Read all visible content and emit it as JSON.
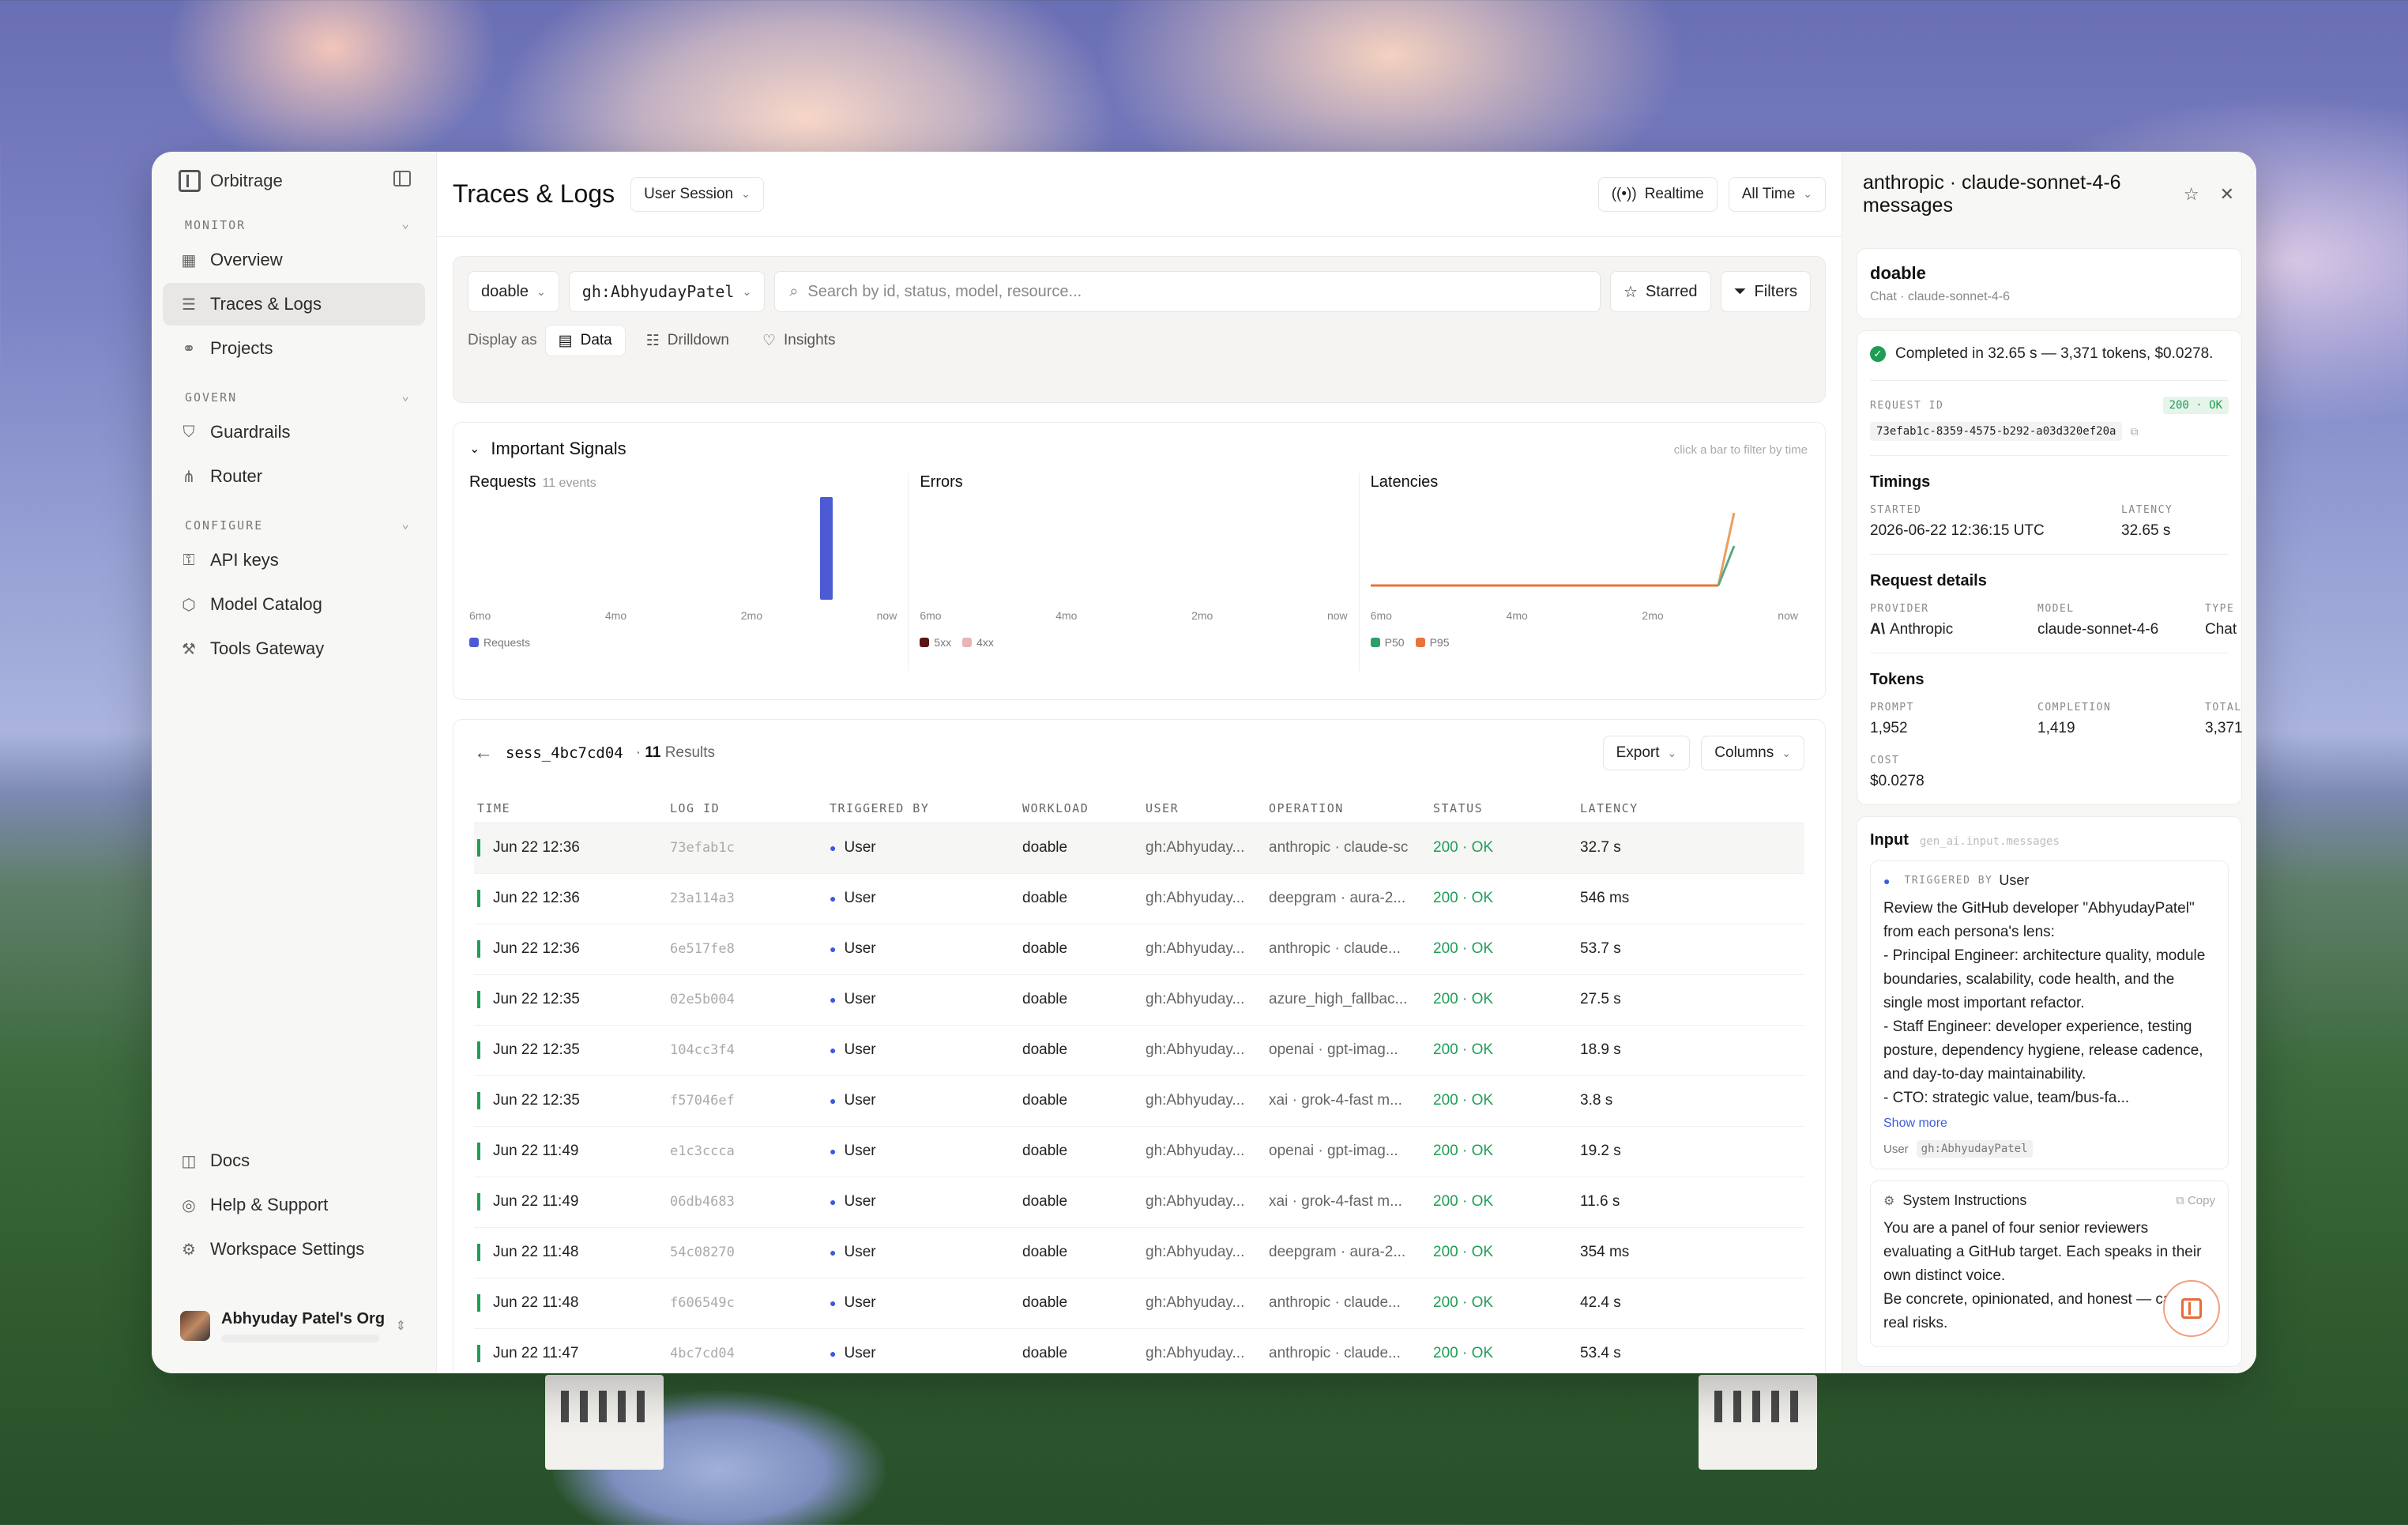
{
  "app": {
    "name": "Orbitrage"
  },
  "sidebar": {
    "sections": [
      {
        "label": "MONITOR",
        "items": [
          {
            "label": "Overview",
            "icon": "grid-icon"
          },
          {
            "label": "Traces & Logs",
            "icon": "list-search-icon",
            "active": true
          },
          {
            "label": "Projects",
            "icon": "share-nodes-icon"
          }
        ]
      },
      {
        "label": "GOVERN",
        "items": [
          {
            "label": "Guardrails",
            "icon": "shield-icon"
          },
          {
            "label": "Router",
            "icon": "router-icon"
          }
        ]
      },
      {
        "label": "CONFIGURE",
        "items": [
          {
            "label": "API keys",
            "icon": "key-icon"
          },
          {
            "label": "Model Catalog",
            "icon": "cube-icon"
          },
          {
            "label": "Tools Gateway",
            "icon": "wrench-icon"
          }
        ]
      }
    ],
    "bottom": [
      {
        "label": "Docs",
        "icon": "book-icon"
      },
      {
        "label": "Help & Support",
        "icon": "help-icon"
      },
      {
        "label": "Workspace Settings",
        "icon": "gear-icon"
      }
    ],
    "org_name": "Abhyuday Patel's Org"
  },
  "topbar": {
    "title": "Traces & Logs",
    "session_select": "User Session",
    "realtime": "Realtime",
    "time_range": "All Time"
  },
  "filters": {
    "project": "doable",
    "user": "gh:AbhyudayPatel",
    "search_placeholder": "Search by id, status, model, resource...",
    "starred": "Starred",
    "filters": "Filters",
    "display_as": "Display as",
    "tabs": [
      "Data",
      "Drilldown",
      "Insights"
    ]
  },
  "signals": {
    "title": "Important Signals",
    "hint": "click a bar to filter by time",
    "requests_title": "Requests",
    "requests_sub": "11 events",
    "errors_title": "Errors",
    "latencies_title": "Latencies",
    "ticks": [
      "6mo",
      "4mo",
      "2mo",
      "now"
    ],
    "legend_requests": "Requests",
    "legend_5xx": "5xx",
    "legend_4xx": "4xx",
    "legend_p50": "P50",
    "legend_p95": "P95"
  },
  "chart_data": [
    {
      "type": "bar",
      "title": "Requests",
      "categories": [
        "6mo",
        "4mo",
        "2mo",
        "now"
      ],
      "series": [
        {
          "name": "Requests",
          "values": [
            0,
            0,
            0,
            11
          ]
        }
      ],
      "color": "#4c5bd4"
    },
    {
      "type": "bar",
      "title": "Errors",
      "categories": [
        "6mo",
        "4mo",
        "2mo",
        "now"
      ],
      "series": [
        {
          "name": "5xx",
          "values": [
            0,
            0,
            0,
            0
          ]
        },
        {
          "name": "4xx",
          "values": [
            0,
            0,
            0,
            0
          ]
        }
      ]
    },
    {
      "type": "line",
      "title": "Latencies",
      "categories": [
        "6mo",
        "4mo",
        "2mo",
        "now"
      ],
      "series": [
        {
          "name": "P50",
          "color": "#2e9e6b"
        },
        {
          "name": "P95",
          "color": "#e8743b"
        }
      ]
    }
  ],
  "results": {
    "session": "sess_4bc7cd04",
    "count": "11",
    "count_label": "Results",
    "export": "Export",
    "columns_btn": "Columns",
    "headers": [
      "TIME",
      "LOG ID",
      "TRIGGERED BY",
      "WORKLOAD",
      "USER",
      "OPERATION",
      "STATUS",
      "LATENCY"
    ],
    "rows": [
      {
        "time": "Jun 22 12:36",
        "log_id": "73efab1c",
        "trigger": "User",
        "workload": "doable",
        "user": "gh:Abhyuday...",
        "operation": "anthropic · claude-sc",
        "status": "200 · OK",
        "latency": "32.7 s"
      },
      {
        "time": "Jun 22 12:36",
        "log_id": "23a114a3",
        "trigger": "User",
        "workload": "doable",
        "user": "gh:Abhyuday...",
        "operation": "deepgram · aura-2...",
        "status": "200 · OK",
        "latency": "546 ms"
      },
      {
        "time": "Jun 22 12:36",
        "log_id": "6e517fe8",
        "trigger": "User",
        "workload": "doable",
        "user": "gh:Abhyuday...",
        "operation": "anthropic · claude...",
        "status": "200 · OK",
        "latency": "53.7 s"
      },
      {
        "time": "Jun 22 12:35",
        "log_id": "02e5b004",
        "trigger": "User",
        "workload": "doable",
        "user": "gh:Abhyuday...",
        "operation": "azure_high_fallbac...",
        "status": "200 · OK",
        "latency": "27.5 s"
      },
      {
        "time": "Jun 22 12:35",
        "log_id": "104cc3f4",
        "trigger": "User",
        "workload": "doable",
        "user": "gh:Abhyuday...",
        "operation": "openai · gpt-imag...",
        "status": "200 · OK",
        "latency": "18.9 s"
      },
      {
        "time": "Jun 22 12:35",
        "log_id": "f57046ef",
        "trigger": "User",
        "workload": "doable",
        "user": "gh:Abhyuday...",
        "operation": "xai · grok-4-fast m...",
        "status": "200 · OK",
        "latency": "3.8 s"
      },
      {
        "time": "Jun 22 11:49",
        "log_id": "e1c3ccca",
        "trigger": "User",
        "workload": "doable",
        "user": "gh:Abhyuday...",
        "operation": "openai · gpt-imag...",
        "status": "200 · OK",
        "latency": "19.2 s"
      },
      {
        "time": "Jun 22 11:49",
        "log_id": "06db4683",
        "trigger": "User",
        "workload": "doable",
        "user": "gh:Abhyuday...",
        "operation": "xai · grok-4-fast m...",
        "status": "200 · OK",
        "latency": "11.6 s"
      },
      {
        "time": "Jun 22 11:48",
        "log_id": "54c08270",
        "trigger": "User",
        "workload": "doable",
        "user": "gh:Abhyuday...",
        "operation": "deepgram · aura-2...",
        "status": "200 · OK",
        "latency": "354 ms"
      },
      {
        "time": "Jun 22 11:48",
        "log_id": "f606549c",
        "trigger": "User",
        "workload": "doable",
        "user": "gh:Abhyuday...",
        "operation": "anthropic · claude...",
        "status": "200 · OK",
        "latency": "42.4 s"
      },
      {
        "time": "Jun 22 11:47",
        "log_id": "4bc7cd04",
        "trigger": "User",
        "workload": "doable",
        "user": "gh:Abhyuday...",
        "operation": "anthropic · claude...",
        "status": "200 · OK",
        "latency": "53.4 s"
      }
    ]
  },
  "detail": {
    "title": "anthropic · claude-sonnet-4-6 messages",
    "workload": "doable",
    "workload_sub": "Chat · claude-sonnet-4-6",
    "completed": "Completed in 32.65 s — 3,371 tokens, $0.0278.",
    "request_id_label": "REQUEST ID",
    "status_badge": "200 · OK",
    "request_id": "73efab1c-8359-4575-b292-a03d320ef20a",
    "timings_title": "Timings",
    "started_label": "STARTED",
    "started": "2026-06-22 12:36:15 UTC",
    "latency_label": "LATENCY",
    "latency": "32.65 s",
    "request_details_title": "Request details",
    "provider_label": "PROVIDER",
    "provider": "Anthropic",
    "model_label": "MODEL",
    "model": "claude-sonnet-4-6",
    "type_label": "TYPE",
    "type": "Chat",
    "tokens_title": "Tokens",
    "prompt_label": "PROMPT",
    "prompt": "1,952",
    "completion_label": "COMPLETION",
    "completion": "1,419",
    "total_label": "TOTAL",
    "total": "3,371",
    "cost_label": "COST",
    "cost": "$0.0278",
    "input_title": "Input",
    "input_path": "gen_ai.input.messages",
    "triggered_by_label": "TRIGGERED BY",
    "triggered_by": "User",
    "message": "Review the GitHub developer \"AbhyudayPatel\" from each persona's lens:\n- Principal Engineer: architecture quality, module boundaries, scalability, code health, and the single most important refactor.\n- Staff Engineer: developer experience, testing posture, dependency hygiene, release cadence, and day-to-day maintainability.\n- CTO: strategic value, team/bus-fa...",
    "show_more": "Show more",
    "user_label": "User",
    "user_tag": "gh:AbhyudayPatel",
    "system_title": "System Instructions",
    "copy": "Copy",
    "system_text": "You are a panel of four senior reviewers evaluating a GitHub target. Each speaks in their own distinct voice.\nBe concrete, opinionated, and honest — call out real risks."
  }
}
